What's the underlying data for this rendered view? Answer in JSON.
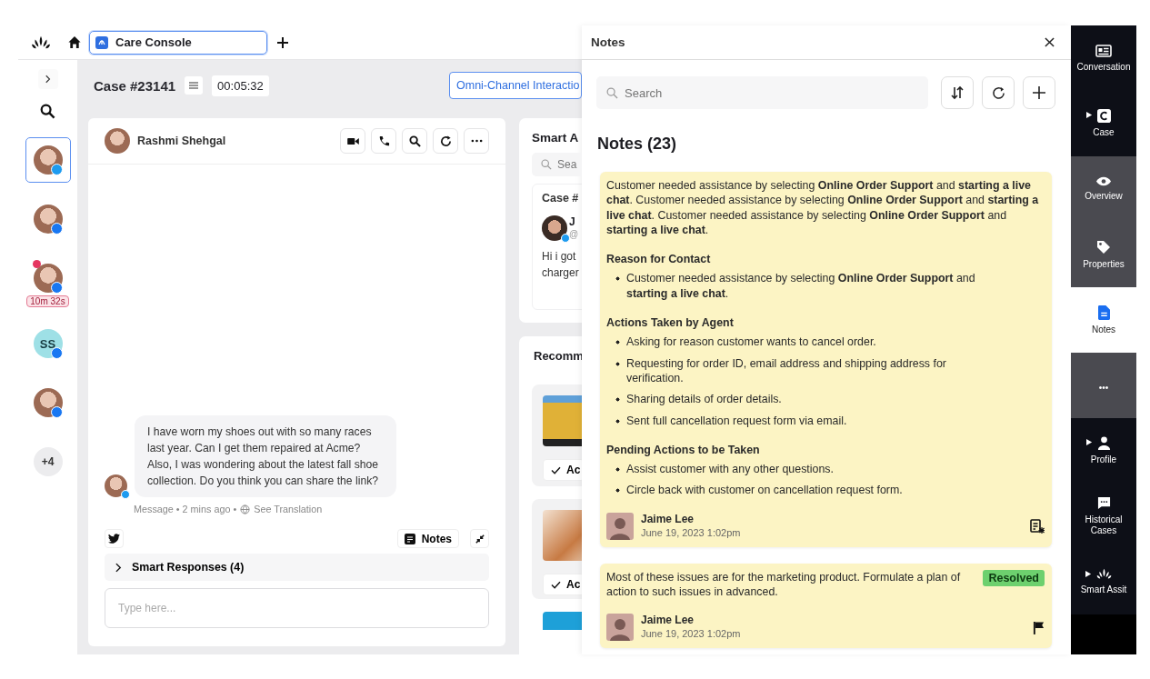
{
  "top_bar": {
    "tab": {
      "label": "Care Console",
      "selected": true
    }
  },
  "left_rail": [
    {
      "kind": "photo",
      "color": "#1d9bf0",
      "selected": true,
      "alert": false
    },
    {
      "kind": "photo",
      "color": "#1877f2",
      "selected": false,
      "alert": false
    },
    {
      "kind": "photo",
      "color": "#1877f2",
      "selected": false,
      "alert": true,
      "timer": "10m 32s"
    },
    {
      "kind": "initials",
      "label": "SS",
      "color": "#1877f2",
      "selected": false,
      "alert": false
    },
    {
      "kind": "photo",
      "color": "#1877f2",
      "selected": false,
      "alert": false
    },
    {
      "kind": "more",
      "label": "+4",
      "selected": false,
      "alert": false
    }
  ],
  "case": {
    "title": "Case #23141",
    "timer": "00:05:32",
    "channel_button": "Omni-Channel Interactio"
  },
  "chat": {
    "contact": "Rashmi Shehgal",
    "message": "I have worn my shoes out with so many races last year. Can I get them repaired at Acme? Also, I was wondering about the latest fall shoe collection. Do you think you can share the link?",
    "meta": "Message • 2 mins ago •",
    "translation_link": "See Translation",
    "notes_button": "Notes",
    "smart_responses": "Smart Responses (4)",
    "input": {
      "placeholder": "Type here..."
    }
  },
  "smart_assist": {
    "title": "Smart A",
    "search": {
      "placeholder": "Sea"
    },
    "case_card": {
      "title": "Case #",
      "name": "J",
      "handle": "@",
      "text_lines": [
        "Hi i got",
        "charger"
      ]
    }
  },
  "recommended": {
    "title": "Recomm",
    "items": [
      {
        "button": "Ac"
      },
      {
        "button": "Ac"
      }
    ]
  },
  "notes_panel": {
    "title": "Notes",
    "search": {
      "placeholder": "Search"
    },
    "heading": "Notes (23)",
    "notes": [
      {
        "paragraph": "Customer needed assistance by selecting **Online Order Support** and **starting a live chat**. Customer needed assistance by selecting **Online Order Support** and **starting a live chat**. Customer needed assistance by selecting **Online Order Support** and **starting a live chat**.",
        "sections": [
          {
            "heading": "Reason for Contact",
            "bullets": [
              "Customer needed assistance by selecting **Online Order Support** and **starting a live chat**."
            ]
          },
          {
            "heading": "Actions Taken by Agent",
            "bullets": [
              "Asking for reason customer wants to cancel order.",
              "Requesting for order ID, email address and shipping address for verification.",
              "Sharing details of order details.",
              "Sent full cancellation request form via email."
            ]
          },
          {
            "heading": "Pending Actions to be Taken",
            "bullets": [
              "Assist customer with any other questions.",
              "Circle back with customer on cancellation request form."
            ]
          }
        ],
        "author": "Jaime Lee",
        "date": "June 19, 2023 1:02pm"
      },
      {
        "paragraph": "Most of these issues are for the marketing product. Formulate a plan of action to such issues in advanced.",
        "badge": "Resolved",
        "author": "Jaime Lee",
        "date": "June 19, 2023 1:02pm"
      }
    ]
  },
  "right_rail": [
    {
      "label": "Conversation",
      "kind": "dark",
      "caret": false,
      "selected": false
    },
    {
      "label": "Case",
      "kind": "dark",
      "caret": true,
      "selected": false
    },
    {
      "label": "Overview",
      "kind": "grey",
      "caret": false,
      "selected": false
    },
    {
      "label": "Properties",
      "kind": "grey",
      "caret": false,
      "selected": false
    },
    {
      "label": "Notes",
      "kind": "grey",
      "caret": false,
      "selected": true
    },
    {
      "label": "•••",
      "kind": "grey",
      "caret": false,
      "selected": false
    },
    {
      "label": "Profile",
      "kind": "dark",
      "caret": true,
      "selected": false
    },
    {
      "label": "Historical Cases",
      "kind": "dark",
      "caret": false,
      "selected": false
    },
    {
      "label": "Smart Assit",
      "kind": "dark",
      "caret": true,
      "selected": false
    }
  ]
}
